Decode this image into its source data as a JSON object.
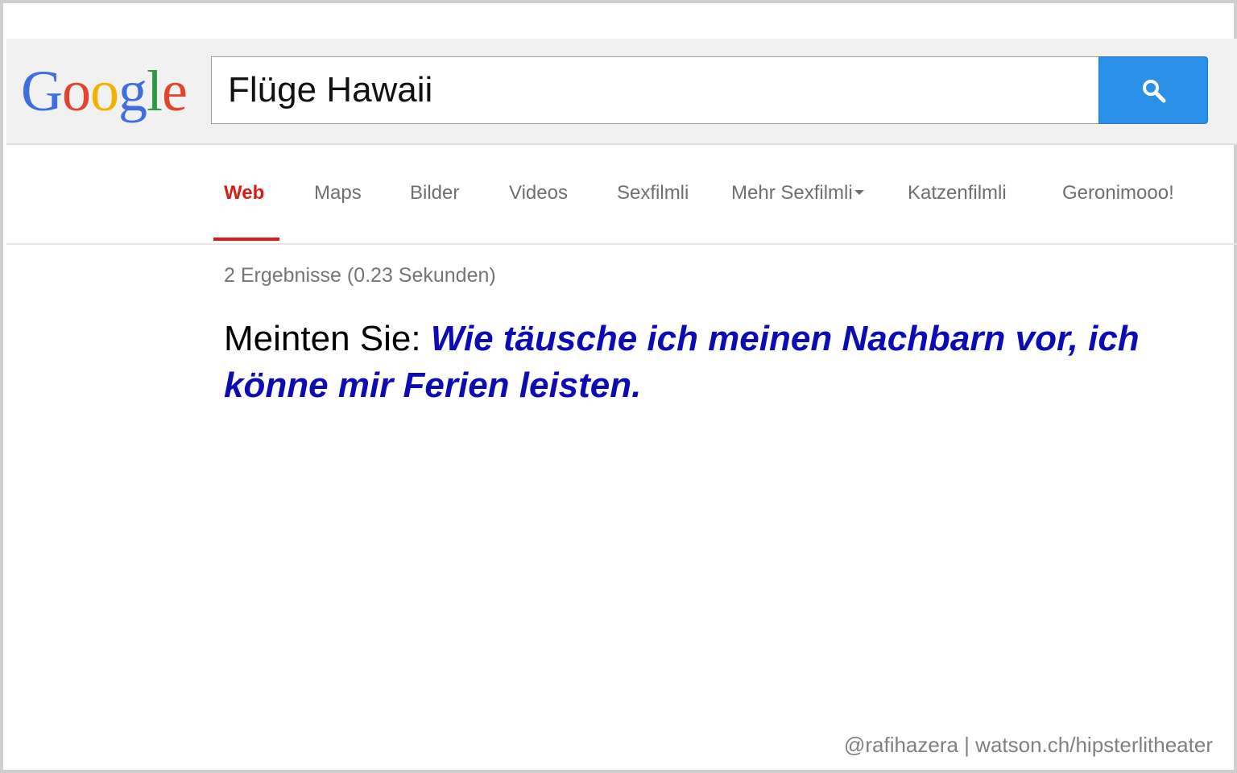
{
  "logo": {
    "letters": [
      "G",
      "o",
      "o",
      "g",
      "l",
      "e"
    ],
    "colors": [
      "#3f6ee0",
      "#e0452e",
      "#f2b300",
      "#3f6ee0",
      "#2a9b45",
      "#e0452e"
    ]
  },
  "search": {
    "value": "Flüge Hawaii",
    "button_icon": "search-icon",
    "button_color": "#2b90e8"
  },
  "nav": {
    "tabs": [
      {
        "label": "Web",
        "active": true
      },
      {
        "label": "Maps"
      },
      {
        "label": "Bilder"
      },
      {
        "label": "Videos"
      },
      {
        "label": "Sexfilmli"
      },
      {
        "label": "Mehr Sexfilmli",
        "has_dropdown": true
      },
      {
        "label": "Katzenfilmli"
      },
      {
        "label": "Geronimooo!"
      }
    ],
    "active_color": "#dd1b16"
  },
  "results": {
    "stats": "2 Ergebnisse (0.23 Sekunden)",
    "did_you_mean_label": "Meinten Sie:",
    "did_you_mean_suggestion": "Wie täusche ich meinen Nachbarn vor, ich könne mir Ferien leisten.",
    "suggestion_color": "#0d0bb3"
  },
  "footer": {
    "credit": "@rafihazera | watson.ch/hipsterlitheater"
  }
}
